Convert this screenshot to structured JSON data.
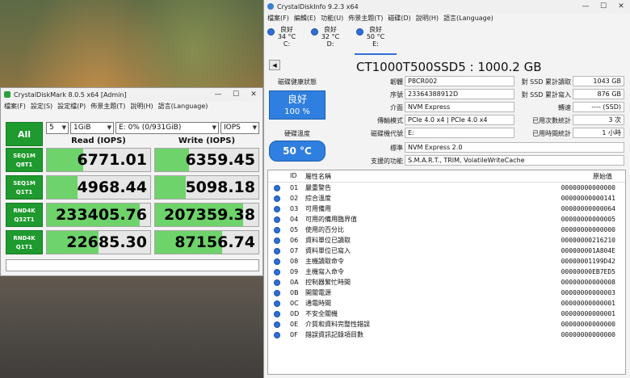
{
  "cdm": {
    "title": "CrystalDiskMark 8.0.5 x64 [Admin]",
    "menu": [
      "檔案(F)",
      "設定(S)",
      "設定檔(P)",
      "佈景主題(T)",
      "說明(H)",
      "語言(Language)"
    ],
    "all_label": "All",
    "count": "5",
    "size": "1GiB",
    "drive": "E: 0% (0/931GiB)",
    "unit": "IOPS",
    "read_header": "Read (IOPS)",
    "write_header": "Write (IOPS)",
    "rows": [
      {
        "line1": "SEQ1M",
        "line2": "Q8T1",
        "read": "6771.01",
        "write": "6359.45",
        "read_fill": 0.35,
        "write_fill": 0.33
      },
      {
        "line1": "SEQ1M",
        "line2": "Q1T1",
        "read": "4968.44",
        "write": "5098.18",
        "read_fill": 0.3,
        "write_fill": 0.3
      },
      {
        "line1": "RND4K",
        "line2": "Q32T1",
        "read": "233405.76",
        "write": "207359.38",
        "read_fill": 0.9,
        "write_fill": 0.85
      },
      {
        "line1": "RND4K",
        "line2": "Q1T1",
        "read": "22685.30",
        "write": "87156.74",
        "read_fill": 0.5,
        "write_fill": 0.65
      }
    ]
  },
  "cdi": {
    "title": "CrystalDiskInfo 9.2.3 x64",
    "menu": [
      "檔案(F)",
      "編輯(E)",
      "功能(U)",
      "佈景主題(T)",
      "磁碟(D)",
      "說明(H)",
      "語言(Language)"
    ],
    "drives": [
      {
        "status": "良好",
        "temp": "34 °C",
        "letter": "C:"
      },
      {
        "status": "良好",
        "temp": "32 °C",
        "letter": "D:"
      },
      {
        "status": "良好",
        "temp": "50 °C",
        "letter": "E:"
      }
    ],
    "disk_title": "CT1000T500SSD5 : 1000.2 GB",
    "health_label": "磁碟健康狀態",
    "health_status": "良好",
    "health_pct": "100 %",
    "temp_label": "硬碟溫度",
    "temp_value": "50 °C",
    "firmware_label": "韌體",
    "firmware": "P8CR002",
    "serial_label": "序號",
    "serial": "23364388912D",
    "interface_label": "介面",
    "interface": "NVM Express",
    "transfer_label": "傳輸模式",
    "transfer": "PCIe 4.0 x4 | PCIe 4.0 x4",
    "drive_letter_label": "磁碟機代號",
    "drive_letter": "E:",
    "standard_label": "標準",
    "standard": "NVM Express 2.0",
    "features_label": "支援的功能",
    "features": "S.M.A.R.T., TRIM, VolatileWriteCache",
    "host_reads_label": "對 SSD 累計讀取",
    "host_reads": "1043 GB",
    "host_writes_label": "對 SSD 累計寫入",
    "host_writes": "876 GB",
    "rotation_label": "轉速",
    "rotation": "---- (SSD)",
    "power_on_count_label": "已用次數統計",
    "power_on_count": "3 次",
    "power_on_hours_label": "已用時間統計",
    "power_on_hours": "1 小時",
    "smart_header": {
      "id": "ID",
      "name": "屬性名稱",
      "raw": "原始值"
    },
    "smart_rows": [
      {
        "id": "01",
        "name": "嚴重警告",
        "raw": "00000000000000"
      },
      {
        "id": "02",
        "name": "綜合溫度",
        "raw": "00000000000141"
      },
      {
        "id": "03",
        "name": "可用備用",
        "raw": "00000000000064"
      },
      {
        "id": "04",
        "name": "可用的備用臨界值",
        "raw": "00000000000005"
      },
      {
        "id": "05",
        "name": "使用的百分比",
        "raw": "00000000000000"
      },
      {
        "id": "06",
        "name": "資料單位已讀取",
        "raw": "00000000216210"
      },
      {
        "id": "07",
        "name": "資料單位已寫入",
        "raw": "000000001A804E"
      },
      {
        "id": "08",
        "name": "主機讀取命令",
        "raw": "00000001199D42"
      },
      {
        "id": "09",
        "name": "主機寫入命令",
        "raw": "00000000EB7ED5"
      },
      {
        "id": "0A",
        "name": "控制器繁忙時間",
        "raw": "00000000000008"
      },
      {
        "id": "0B",
        "name": "開關電源",
        "raw": "00000000000003"
      },
      {
        "id": "0C",
        "name": "通電時間",
        "raw": "00000000000001"
      },
      {
        "id": "0D",
        "name": "不安全關機",
        "raw": "00000000000001"
      },
      {
        "id": "0E",
        "name": "介質和資料完整性錯誤",
        "raw": "00000000000000"
      },
      {
        "id": "0F",
        "name": "錯誤資訊記錄項目數",
        "raw": "00000000000000"
      }
    ]
  },
  "colors": {
    "accent_green": "#1f9a2e",
    "bar_green": "#6fd36b",
    "health_blue": "#2f7fe0"
  }
}
